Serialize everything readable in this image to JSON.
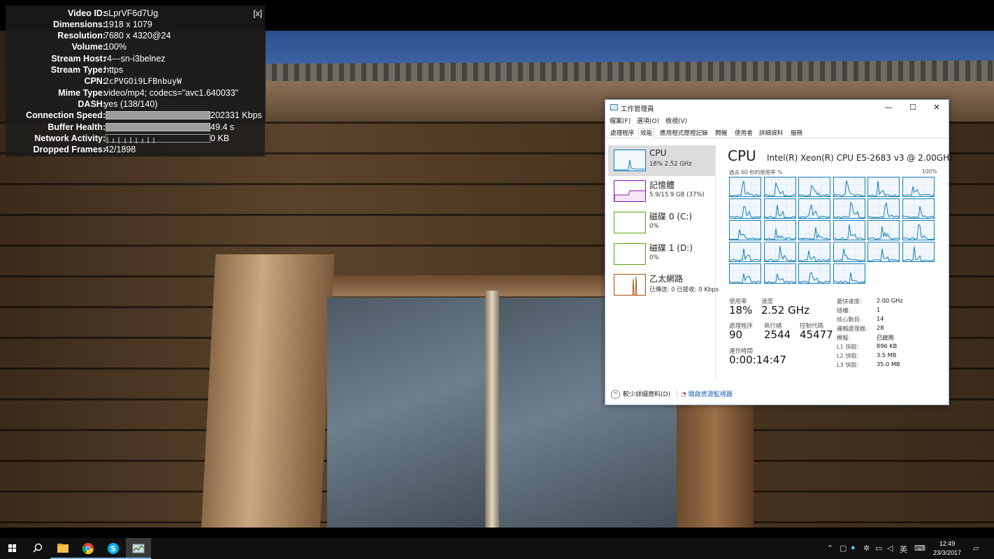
{
  "stats": {
    "close_label": "[x]",
    "rows": [
      {
        "label": "Video ID:",
        "value": "sLprVF6d7Ug"
      },
      {
        "label": "Dimensions:",
        "value": "1918 x 1079"
      },
      {
        "label": "Resolution:",
        "value": "7680 x 4320@24"
      },
      {
        "label": "Volume:",
        "value": "100%"
      },
      {
        "label": "Stream Host:",
        "value": "r4---sn-i3belnez"
      },
      {
        "label": "Stream Type:",
        "value": "https"
      },
      {
        "label": "CPN:",
        "value": "2cPVGOi9LFBnbuyW"
      },
      {
        "label": "Mime Type:",
        "value": "video/mp4; codecs=\"avc1.640033\""
      },
      {
        "label": "DASH:",
        "value": "yes (138/140)"
      }
    ],
    "connection_speed": {
      "label": "Connection Speed:",
      "value": "202331 Kbps"
    },
    "buffer_health": {
      "label": "Buffer Health:",
      "value": "49.4 s"
    },
    "network_activity": {
      "label": "Network Activity:",
      "value": "0 KB"
    },
    "dropped_frames": {
      "label": "Dropped Frames:",
      "value": "42/1898"
    }
  },
  "taskmgr": {
    "title": "工作管理員",
    "window_buttons": {
      "minimize": "—",
      "maximize": "☐",
      "close": "✕"
    },
    "menu": [
      "檔案(F)",
      "選項(O)",
      "檢視(V)"
    ],
    "tabs": [
      "處理程序",
      "效能",
      "應用程式歷程記錄",
      "開機",
      "使用者",
      "詳細資料",
      "服務"
    ],
    "active_tab": "效能",
    "resources": [
      {
        "name": "CPU",
        "sub": "18%  2.52 GHz",
        "color": "#117dbb"
      },
      {
        "name": "記憶體",
        "sub": "5.9/15.9 GB (37%)",
        "color": "#8b12ae"
      },
      {
        "name": "磁碟 0 (C:)",
        "sub": "0%",
        "color": "#4da60c"
      },
      {
        "name": "磁碟 1 (D:)",
        "sub": "0%",
        "color": "#4da60c"
      },
      {
        "name": "乙太網路",
        "sub": "已傳送: 0 已接收: 0 Kbps",
        "color": "#a74f01"
      }
    ],
    "cpu": {
      "title": "CPU",
      "model": "Intel(R) Xeon(R) CPU E5-2683 v3 @ 2.00GHz",
      "graph_label_left": "過去 60 秒的使用率 %",
      "graph_label_right": "100%",
      "core_count": 28,
      "stats": [
        {
          "label": "使用率",
          "value": "18%"
        },
        {
          "label": "速度",
          "value": "2.52 GHz"
        },
        {
          "label": "處理程序",
          "value": "90"
        },
        {
          "label": "執行緒",
          "value": "2544"
        },
        {
          "label": "控制代碼",
          "value": "45477"
        },
        {
          "label": "運作時間",
          "value": "0:00:14:47"
        }
      ],
      "specs": [
        {
          "label": "最快速度:",
          "value": "2.00 GHz"
        },
        {
          "label": "插槽:",
          "value": "1"
        },
        {
          "label": "核心數目:",
          "value": "14"
        },
        {
          "label": "邏輯處理器:",
          "value": "28"
        },
        {
          "label": "模擬:",
          "value": "已啟用"
        },
        {
          "label": "L1 快取:",
          "value": "896 KB"
        },
        {
          "label": "L2 快取:",
          "value": "3.5 MB"
        },
        {
          "label": "L3 快取:",
          "value": "35.0 MB"
        }
      ]
    },
    "footer": {
      "fewer_details": "較少詳細資料(D)",
      "open_monitor": "開啟資源監視器"
    }
  },
  "taskbar": {
    "clock_time": "12:49",
    "clock_date": "23/3/2017",
    "ime": "英"
  }
}
